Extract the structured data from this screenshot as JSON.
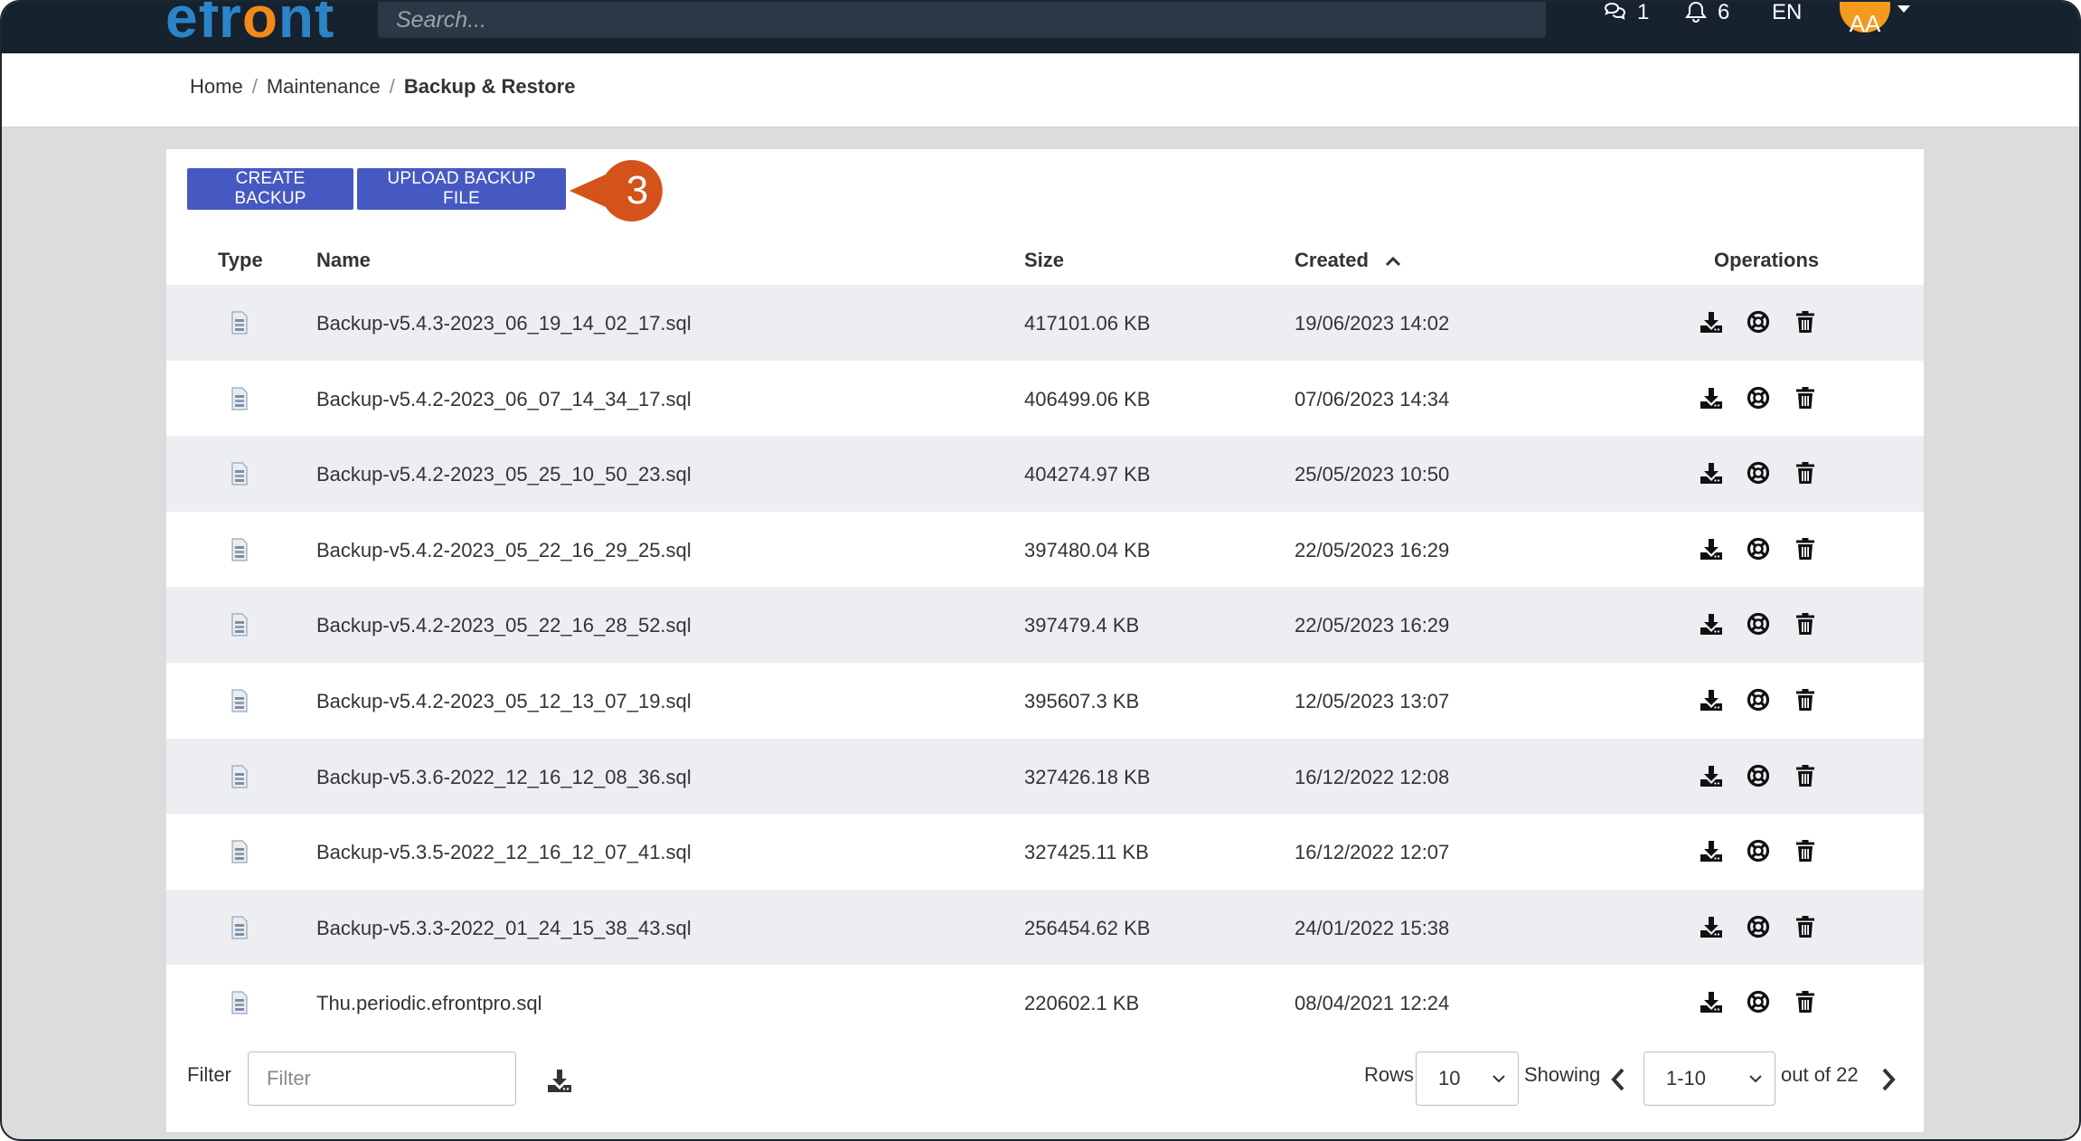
{
  "header": {
    "logo_prefix": "efr",
    "logo_o": "o",
    "logo_suffix": "nt",
    "search_placeholder": "Search...",
    "messages_count": "1",
    "notifications_count": "6",
    "language": "EN",
    "user_initials": "AA"
  },
  "breadcrumb": {
    "home": "Home",
    "maintenance": "Maintenance",
    "current": "Backup & Restore",
    "separator": "/"
  },
  "toolbar": {
    "create_label": "CREATE BACKUP",
    "upload_label": "UPLOAD BACKUP FILE",
    "callout_number": "3",
    "callout_color": "#d4531a"
  },
  "table": {
    "columns": {
      "type": "Type",
      "name": "Name",
      "size": "Size",
      "created": "Created",
      "operations": "Operations"
    },
    "sort": {
      "column": "created",
      "direction": "ascending-icon"
    },
    "rows": [
      {
        "name": "Backup-v5.4.3-2023_06_19_14_02_17.sql",
        "size": "417101.06 KB",
        "created": "19/06/2023 14:02"
      },
      {
        "name": "Backup-v5.4.2-2023_06_07_14_34_17.sql",
        "size": "406499.06 KB",
        "created": "07/06/2023 14:34"
      },
      {
        "name": "Backup-v5.4.2-2023_05_25_10_50_23.sql",
        "size": "404274.97 KB",
        "created": "25/05/2023 10:50"
      },
      {
        "name": "Backup-v5.4.2-2023_05_22_16_29_25.sql",
        "size": "397480.04 KB",
        "created": "22/05/2023 16:29"
      },
      {
        "name": "Backup-v5.4.2-2023_05_22_16_28_52.sql",
        "size": "397479.4 KB",
        "created": "22/05/2023 16:29"
      },
      {
        "name": "Backup-v5.4.2-2023_05_12_13_07_19.sql",
        "size": "395607.3 KB",
        "created": "12/05/2023 13:07"
      },
      {
        "name": "Backup-v5.3.6-2022_12_16_12_08_36.sql",
        "size": "327426.18 KB",
        "created": "16/12/2022 12:08"
      },
      {
        "name": "Backup-v5.3.5-2022_12_16_12_07_41.sql",
        "size": "327425.11 KB",
        "created": "16/12/2022 12:07"
      },
      {
        "name": "Backup-v5.3.3-2022_01_24_15_38_43.sql",
        "size": "256454.62 KB",
        "created": "24/01/2022 15:38"
      },
      {
        "name": "Thu.periodic.efrontpro.sql",
        "size": "220602.1 KB",
        "created": "08/04/2021 12:24"
      }
    ],
    "row_icons": [
      "file-icon",
      "download-icon",
      "restore-lifebuoy-icon",
      "trash-icon"
    ]
  },
  "footer": {
    "filter_label": "Filter",
    "filter_placeholder": "Filter",
    "rows_label": "Rows",
    "rows_value": "10",
    "showing_label": "Showing",
    "range_value": "1-10",
    "total_text": "out of 22"
  },
  "colors": {
    "navbar": "#16222e",
    "primary_button": "#4659c2",
    "logo_blue": "#2b84c7",
    "logo_orange": "#f28a1b",
    "avatar": "#f39a1f",
    "striped_row": "#edeef2"
  }
}
